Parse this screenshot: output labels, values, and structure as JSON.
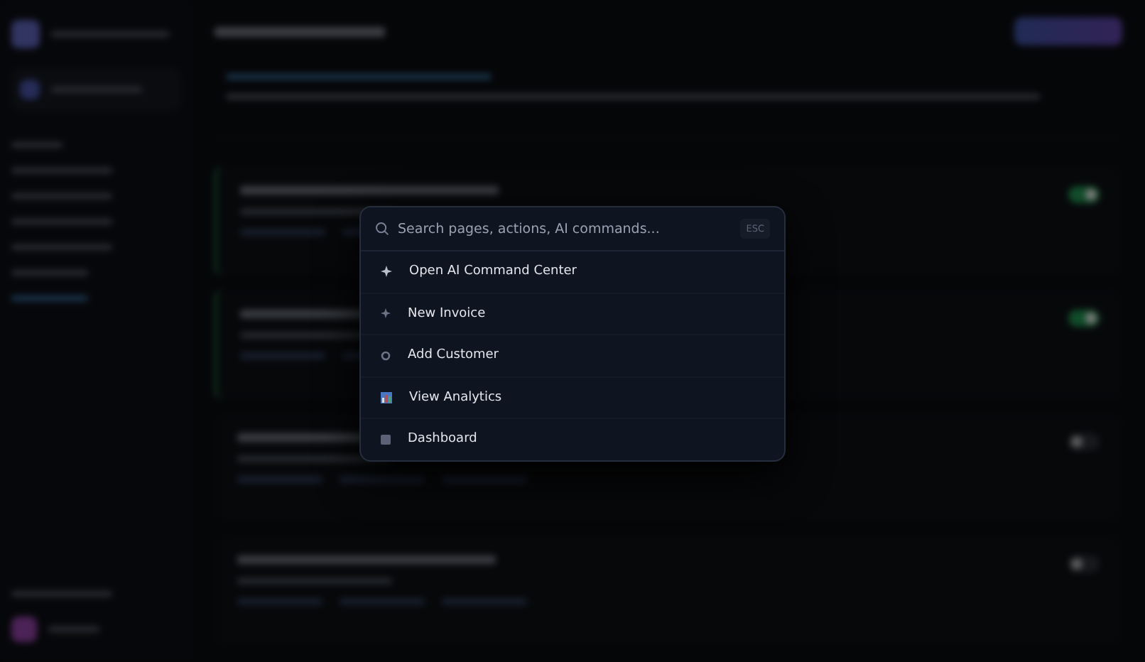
{
  "background": {
    "workflows": [
      {
        "on": true
      },
      {
        "on": true
      },
      {
        "on": false
      },
      {
        "on": false
      }
    ]
  },
  "palette": {
    "placeholder": "Search pages, actions, AI commands...",
    "shortcut": "ESC",
    "items": [
      {
        "kind": "sparkle",
        "label": "Open AI Command Center"
      },
      {
        "kind": "sparkle-dim",
        "label": "New Invoice"
      },
      {
        "kind": "ring",
        "label": "Add Customer"
      },
      {
        "kind": "chart",
        "label": "View Analytics"
      },
      {
        "kind": "square",
        "label": "Dashboard"
      }
    ]
  }
}
